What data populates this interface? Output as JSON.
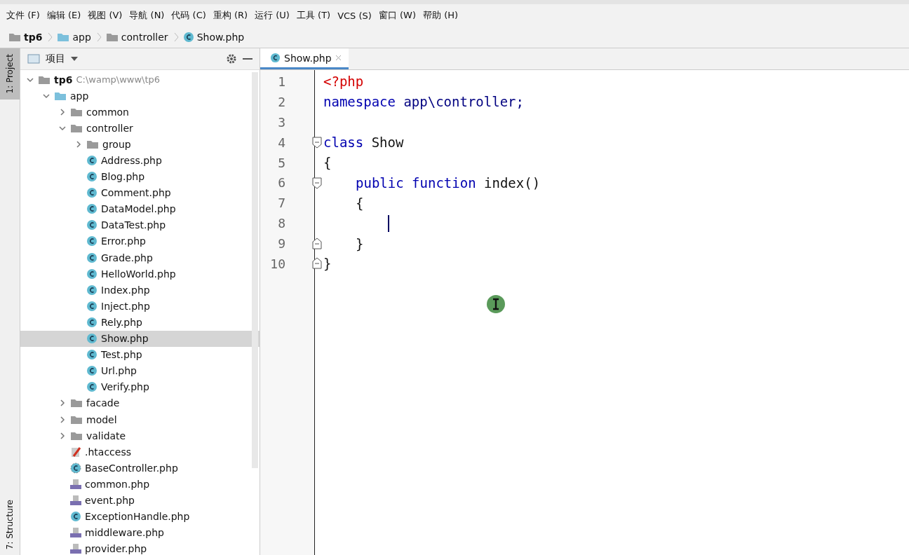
{
  "menu": [
    "文件 (F)",
    "编辑 (E)",
    "视图 (V)",
    "导航 (N)",
    "代码 (C)",
    "重构 (R)",
    "运行 (U)",
    "工具 (T)",
    "VCS (S)",
    "窗口 (W)",
    "帮助 (H)"
  ],
  "breadcrumb": [
    {
      "label": "tp6",
      "kind": "root"
    },
    {
      "label": "app",
      "kind": "source"
    },
    {
      "label": "controller",
      "kind": "folder"
    },
    {
      "label": "Show.php",
      "kind": "class"
    }
  ],
  "side_strip": {
    "top": "1: Project",
    "bottom": "7: Structure"
  },
  "project_panel": {
    "title": "项目"
  },
  "tree": [
    {
      "name": "tp6",
      "path": "C:\\wamp\\www\\tp6",
      "kind": "root",
      "expanded": true,
      "selected": false,
      "children": [
        {
          "name": "app",
          "kind": "source",
          "expanded": true,
          "selected": false,
          "children": [
            {
              "name": "common",
              "kind": "folder",
              "expanded": false,
              "selected": false
            },
            {
              "name": "controller",
              "kind": "folder",
              "expanded": true,
              "selected": false,
              "children": [
                {
                  "name": "group",
                  "kind": "folder",
                  "expanded": false,
                  "selected": false
                },
                {
                  "name": "Address.php",
                  "kind": "class",
                  "selected": false
                },
                {
                  "name": "Blog.php",
                  "kind": "class",
                  "selected": false
                },
                {
                  "name": "Comment.php",
                  "kind": "class",
                  "selected": false
                },
                {
                  "name": "DataModel.php",
                  "kind": "class",
                  "selected": false
                },
                {
                  "name": "DataTest.php",
                  "kind": "class",
                  "selected": false
                },
                {
                  "name": "Error.php",
                  "kind": "class",
                  "selected": false
                },
                {
                  "name": "Grade.php",
                  "kind": "class",
                  "selected": false
                },
                {
                  "name": "HelloWorld.php",
                  "kind": "class",
                  "selected": false
                },
                {
                  "name": "Index.php",
                  "kind": "class",
                  "selected": false
                },
                {
                  "name": "Inject.php",
                  "kind": "class",
                  "selected": false
                },
                {
                  "name": "Rely.php",
                  "kind": "class",
                  "selected": false
                },
                {
                  "name": "Show.php",
                  "kind": "class",
                  "selected": true
                },
                {
                  "name": "Test.php",
                  "kind": "class",
                  "selected": false
                },
                {
                  "name": "Url.php",
                  "kind": "class",
                  "selected": false
                },
                {
                  "name": "Verify.php",
                  "kind": "class",
                  "selected": false
                }
              ]
            },
            {
              "name": "facade",
              "kind": "folder",
              "expanded": false,
              "selected": false
            },
            {
              "name": "model",
              "kind": "folder",
              "expanded": false,
              "selected": false
            },
            {
              "name": "validate",
              "kind": "folder",
              "expanded": false,
              "selected": false
            },
            {
              "name": ".htaccess",
              "kind": "htaccess",
              "selected": false
            },
            {
              "name": "BaseController.php",
              "kind": "abstract",
              "selected": false
            },
            {
              "name": "common.php",
              "kind": "php",
              "selected": false
            },
            {
              "name": "event.php",
              "kind": "php",
              "selected": false
            },
            {
              "name": "ExceptionHandle.php",
              "kind": "class",
              "selected": false
            },
            {
              "name": "middleware.php",
              "kind": "php",
              "selected": false
            },
            {
              "name": "provider.php",
              "kind": "php",
              "selected": false
            }
          ]
        }
      ]
    }
  ],
  "tabs": [
    {
      "label": "Show.php",
      "selected": true
    }
  ],
  "code": [
    {
      "number": "1",
      "kind": "top",
      "tokens": [
        {
          "text": "<?php",
          "kind": "tag"
        }
      ]
    },
    {
      "number": "2",
      "kind": "top",
      "tokens": [
        {
          "text": "namespace",
          "kind": "keyword"
        },
        {
          "text": " app\\controller;",
          "kind": "ns"
        }
      ]
    },
    {
      "number": "3",
      "kind": "top"
    },
    {
      "number": "4",
      "kind": "top",
      "fold_start": true,
      "tokens": [
        {
          "text": "class",
          "kind": "keyword"
        },
        {
          "text": " Show",
          "kind": "plain"
        }
      ]
    },
    {
      "number": "5",
      "kind": "top",
      "tokens": [
        {
          "text": "{",
          "kind": "plain"
        }
      ]
    },
    {
      "number": "6",
      "kind": "member",
      "fold_start": true,
      "tokens": [
        {
          "text": "public",
          "kind": "keyword"
        },
        {
          "text": " function",
          "kind": "keyword"
        },
        {
          "text": " index()",
          "kind": "plain"
        }
      ]
    },
    {
      "number": "7",
      "kind": "member",
      "tokens": [
        {
          "text": "{",
          "kind": "plain"
        }
      ]
    },
    {
      "number": "8",
      "kind": "body",
      "caret": true
    },
    {
      "number": "9",
      "kind": "member",
      "fold_end": true,
      "tokens": [
        {
          "text": "}",
          "kind": "plain"
        }
      ]
    },
    {
      "number": "10",
      "kind": "top",
      "fold_end": true,
      "tokens": [
        {
          "text": "}",
          "kind": "plain"
        }
      ]
    }
  ]
}
